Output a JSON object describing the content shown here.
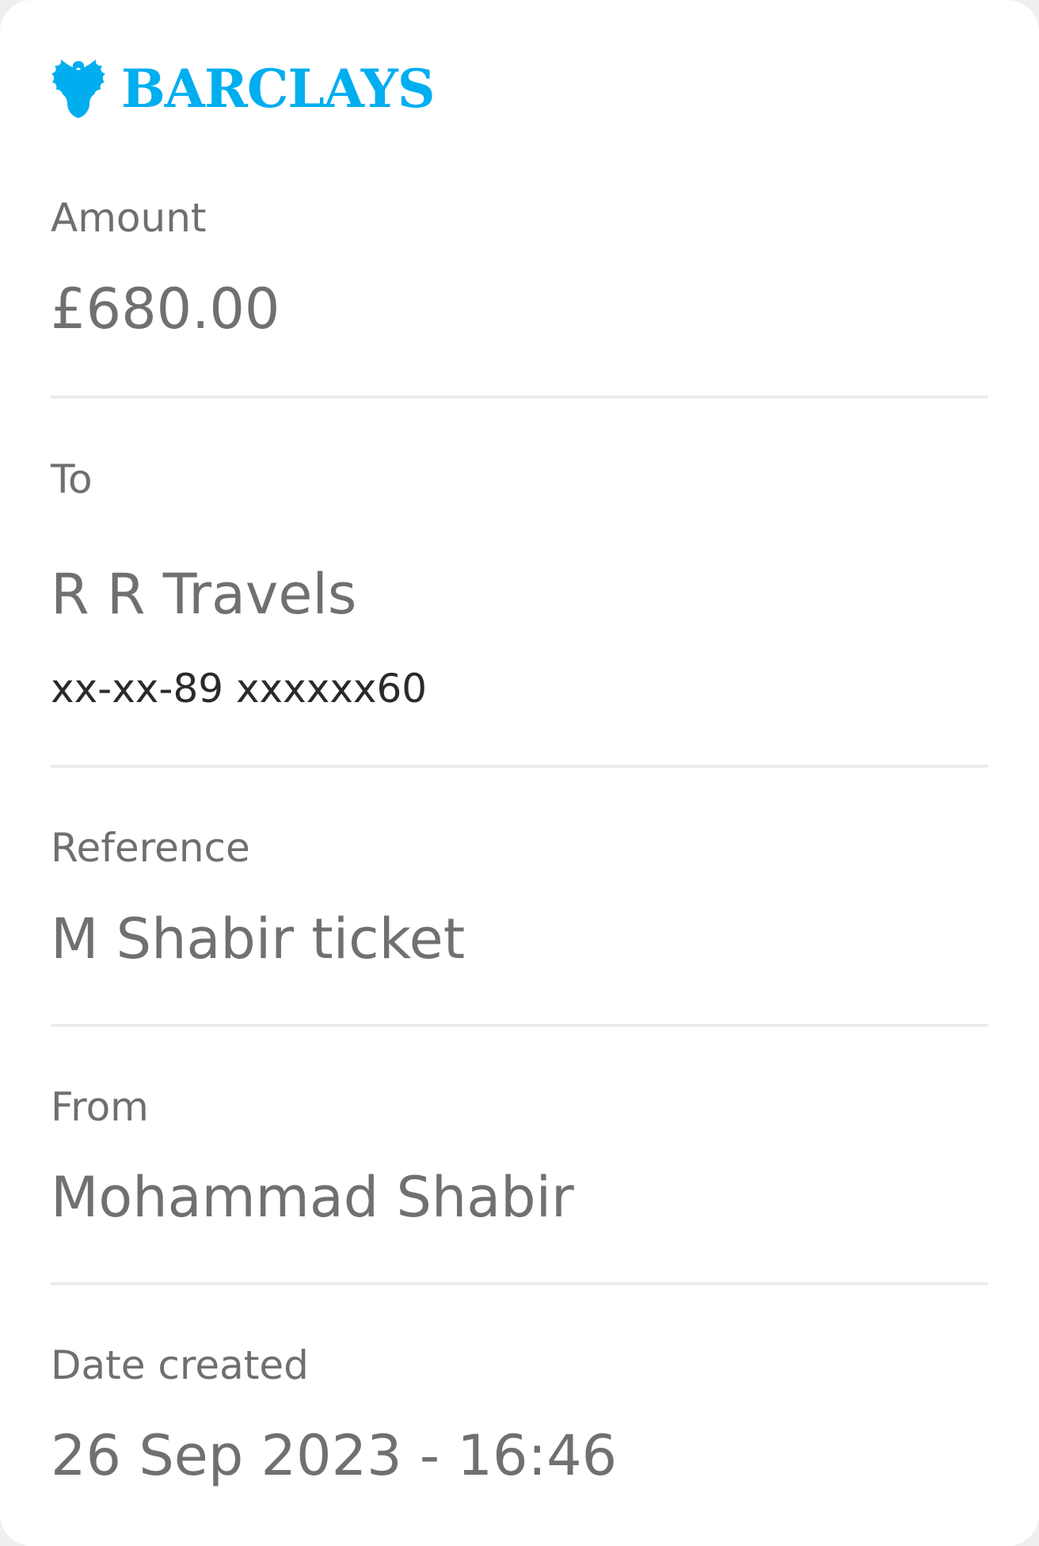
{
  "brand": {
    "name": "BARCLAYS",
    "color": "#00aeef",
    "logo_icon": "eagle-icon"
  },
  "amount": {
    "label": "Amount",
    "value": "£680.00"
  },
  "to": {
    "label": "To",
    "name": "R R Travels",
    "account": "xx-xx-89 xxxxxx60"
  },
  "reference": {
    "label": "Reference",
    "value": "M Shabir ticket"
  },
  "from": {
    "label": "From",
    "value": "Mohammad Shabir"
  },
  "date_created": {
    "label": "Date created",
    "value": "26 Sep 2023 - 16:46"
  }
}
